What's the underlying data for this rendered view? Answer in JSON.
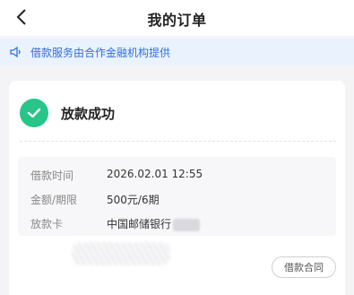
{
  "header": {
    "title": "我的订单",
    "back_icon": "chevron-left-icon"
  },
  "notice": {
    "text": "借款服务由合作金融机构提供",
    "icon": "speaker-icon",
    "color": "#2f6fe0"
  },
  "status": {
    "text": "放款成功",
    "icon": "check-circle-icon",
    "color": "#27c589"
  },
  "details": [
    {
      "label": "借款时间",
      "value": "2026.02.01 12:55"
    },
    {
      "label": "金额/期限",
      "value": "500元/6期"
    },
    {
      "label": "放款卡",
      "value": "中国邮储银行"
    }
  ],
  "footer": {
    "contract_button": "借款合同"
  }
}
